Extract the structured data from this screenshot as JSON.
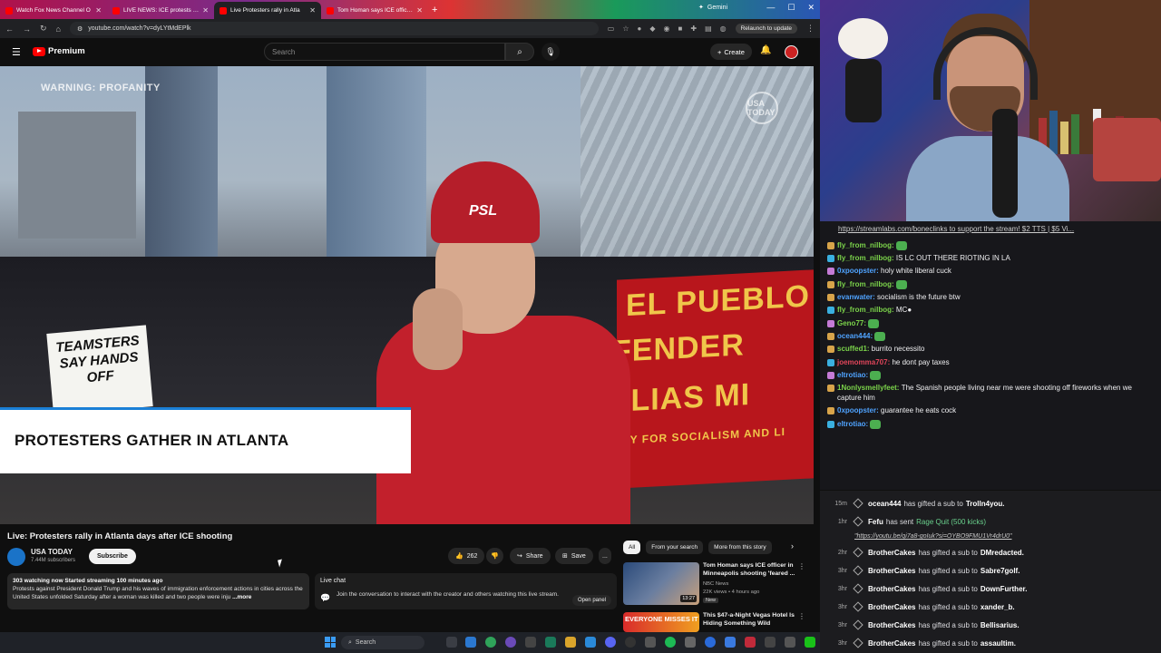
{
  "browser": {
    "tabs": [
      {
        "label": "Watch Fox News Channel O",
        "active": false
      },
      {
        "label": "LIVE NEWS: ICE protests contin",
        "active": false
      },
      {
        "label": "Live Protesters rally in Atla",
        "active": true
      },
      {
        "label": "Tom Homan says ICE officer in",
        "active": false
      }
    ],
    "gemini_label": "Gemini",
    "url": "youtube.com/watch?v=dyLYtMdEPlk",
    "relaunch_label": "Relaunch to update"
  },
  "yt": {
    "logo_label": "Premium",
    "search_placeholder": "Search",
    "create_label": "Create",
    "video_overlay": {
      "warning": "WARNING: PROFANITY",
      "bug": "USA TODAY",
      "lower_third": "PROTESTERS GATHER IN ATLANTA",
      "sign_text": "TEAMSTERS SAY HANDS OFF",
      "banner_line1": "EL PUEBLO",
      "banner_line2": "FENDER",
      "banner_line3": "ILIAS MI",
      "banner_line4": "NY FOR SOCIALISM AND LI",
      "hat_text": "PSL"
    },
    "title": "Live: Protesters rally in Atlanta days after ICE shooting",
    "channel": {
      "name": "USA TODAY",
      "subscribers": "7.44M subscribers",
      "subscribe_label": "Subscribe"
    },
    "actions": {
      "likes": "262",
      "share": "Share",
      "save": "Save",
      "more": "..."
    },
    "description": {
      "stats": "303 watching now  Started streaming 100 minutes ago",
      "text": "Protests against President Donald Trump and his waves of immigration enforcement actions in cities across the United States unfolded Saturday after a woman was killed and two people were inju",
      "more": "...more"
    },
    "live_chat": {
      "label": "Live chat",
      "text": "Join the conversation to interact with the creator and others watching this live stream.",
      "open_panel": "Open panel"
    },
    "chips": [
      "All",
      "From your search",
      "More from this story"
    ],
    "recs": [
      {
        "title": "Tom Homan says ICE officer in Minneapolis shooting 'feared ...",
        "channel": "NBC News",
        "meta": "22K views • 4 hours ago",
        "badge": "New",
        "duration": "13:27"
      },
      {
        "title": "This $47-a-Night Vegas Hotel Is Hiding Something Wild",
        "thumb_text": "EVERYONE MISSES IT"
      }
    ]
  },
  "taskbar": {
    "search_label": "Search"
  },
  "stream": {
    "top_banner": "https://streamlabs.com/boneclinks to support the stream! $2 TTS | $5 Vi...",
    "chat": [
      {
        "user": "fly_from_nilbog:",
        "color": "#7bd34a",
        "text": "",
        "emote": true
      },
      {
        "user": "fly_from_nilbog:",
        "color": "#7bd34a",
        "text": "IS LC OUT THERE RIOTING IN LA",
        "emote": false
      },
      {
        "user": "0xpoopster:",
        "color": "#4fa3ff",
        "text": "holy white liberal cuck",
        "emote": false
      },
      {
        "user": "fly_from_nilbog:",
        "color": "#7bd34a",
        "text": "",
        "emote": true
      },
      {
        "user": "evanwater:",
        "color": "#4fa3ff",
        "text": "socialism is the future btw",
        "emote": false
      },
      {
        "user": "fly_from_nilbog:",
        "color": "#7bd34a",
        "text": "MC●",
        "emote": false
      },
      {
        "user": "Geno77:",
        "color": "#7bd34a",
        "text": "",
        "emote": true
      },
      {
        "user": "ocean444:",
        "color": "#4fa3ff",
        "text": "",
        "emote": true
      },
      {
        "user": "scuffed1:",
        "color": "#7bd34a",
        "text": "burrito necessito",
        "emote": false
      },
      {
        "user": "joemomma707:",
        "color": "#e0455a",
        "text": "he dont pay taxes",
        "emote": false
      },
      {
        "user": "eltrotiao:",
        "color": "#4fa3ff",
        "text": "",
        "emote": true
      },
      {
        "user": "1Nonlysmellyfeet:",
        "color": "#7bd34a",
        "text": "The Spanish people living near me were shooting off fireworks when we capture him",
        "emote": false
      },
      {
        "user": "0xpoopster:",
        "color": "#4fa3ff",
        "text": "guarantee he eats cock",
        "emote": false
      },
      {
        "user": "eltrotiao:",
        "color": "#4fa3ff",
        "text": "",
        "emote": true
      }
    ],
    "events": [
      {
        "time": "15m",
        "user": "ocean444",
        "action": "has gifted a sub to",
        "target": "Trolln4you."
      },
      {
        "time": "1hr",
        "user": "Fefu",
        "action": "has sent",
        "highlight": "Rage Quit (500 kicks)",
        "target": "",
        "link": "\"https://youtu.be/qi7a8-goIuk?si=OYBO9FMU1Vr4drU0\""
      },
      {
        "time": "2hr",
        "user": "BrotherCakes",
        "action": "has gifted a sub to",
        "target": "DMredacted."
      },
      {
        "time": "3hr",
        "user": "BrotherCakes",
        "action": "has gifted a sub to",
        "target": "Sabre7golf."
      },
      {
        "time": "3hr",
        "user": "BrotherCakes",
        "action": "has gifted a sub to",
        "target": "DownFurther."
      },
      {
        "time": "3hr",
        "user": "BrotherCakes",
        "action": "has gifted a sub to",
        "target": "xander_b."
      },
      {
        "time": "3hr",
        "user": "BrotherCakes",
        "action": "has gifted a sub to",
        "target": "Bellisarius."
      },
      {
        "time": "3hr",
        "user": "BrotherCakes",
        "action": "has gifted a sub to",
        "target": "assaultim."
      }
    ]
  }
}
